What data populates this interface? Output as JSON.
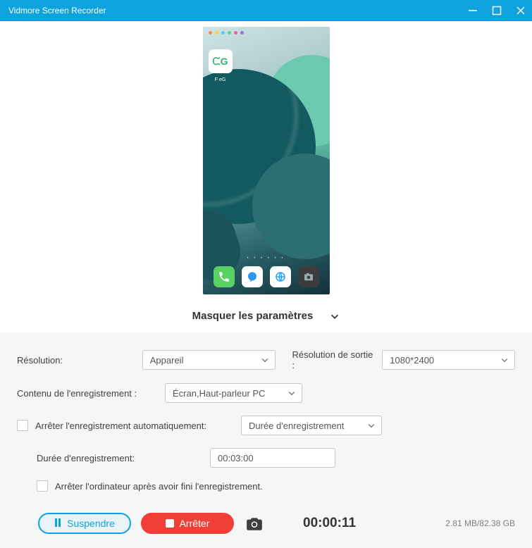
{
  "window": {
    "title": "Vidmore Screen Recorder"
  },
  "toggle": {
    "label": "Masquer les paramètres"
  },
  "settings": {
    "resolution_label": "Résolution:",
    "resolution_value": "Appareil",
    "output_res_label": "Résolution de sortie :",
    "output_res_value": "1080*2400",
    "content_label": "Contenu de l'enregistrement :",
    "content_value": "Écran,Haut-parleur PC",
    "auto_stop_label": "Arrêter l'enregistrement automatiquement:",
    "auto_stop_mode": "Durée d'enregistrement",
    "duration_label": "Durée d'enregistrement:",
    "duration_value": "00:03:00",
    "shutdown_label": "Arrêter l'ordinateur après avoir fini l'enregistrement."
  },
  "footer": {
    "suspend": "Suspendre",
    "stop": "Arrêter",
    "timer": "00:00:11",
    "storage": "2.81 MB/82.38 GB"
  },
  "phone": {
    "app_badge": "ᙅG",
    "app_label": "F  eG",
    "dock_icons": [
      "phone-icon",
      "message-icon",
      "globe-icon",
      "camera-icon"
    ]
  }
}
